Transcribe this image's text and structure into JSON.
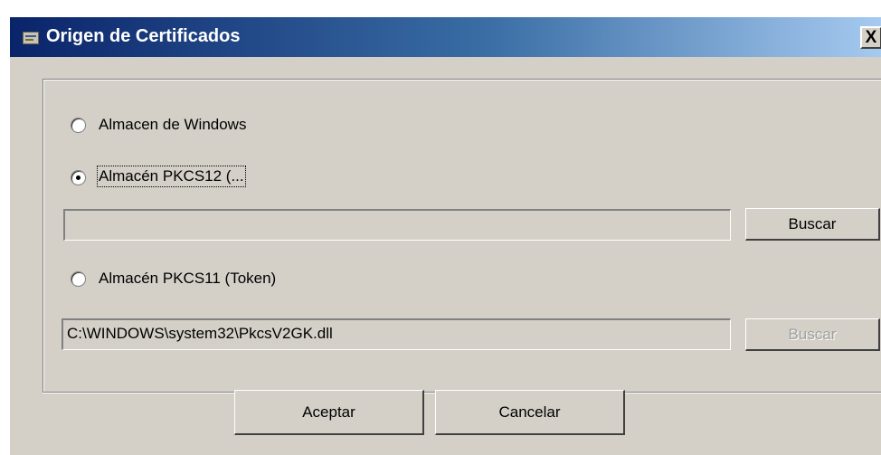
{
  "window": {
    "title": "Origen de Certificados",
    "close_label": "X"
  },
  "options": {
    "windows_store": {
      "label": "Almacen de Windows",
      "selected": false
    },
    "pkcs12": {
      "label": "Almacén PKCS12 (...",
      "selected": true,
      "path_value": "",
      "browse_label": "Buscar"
    },
    "pkcs11": {
      "label": "Almacén PKCS11 (Token)",
      "selected": false,
      "path_value": "C:\\WINDOWS\\system32\\PkcsV2GK.dll",
      "browse_label": "Buscar",
      "browse_enabled": false
    }
  },
  "footer": {
    "accept_label": "Aceptar",
    "cancel_label": "Cancelar"
  }
}
